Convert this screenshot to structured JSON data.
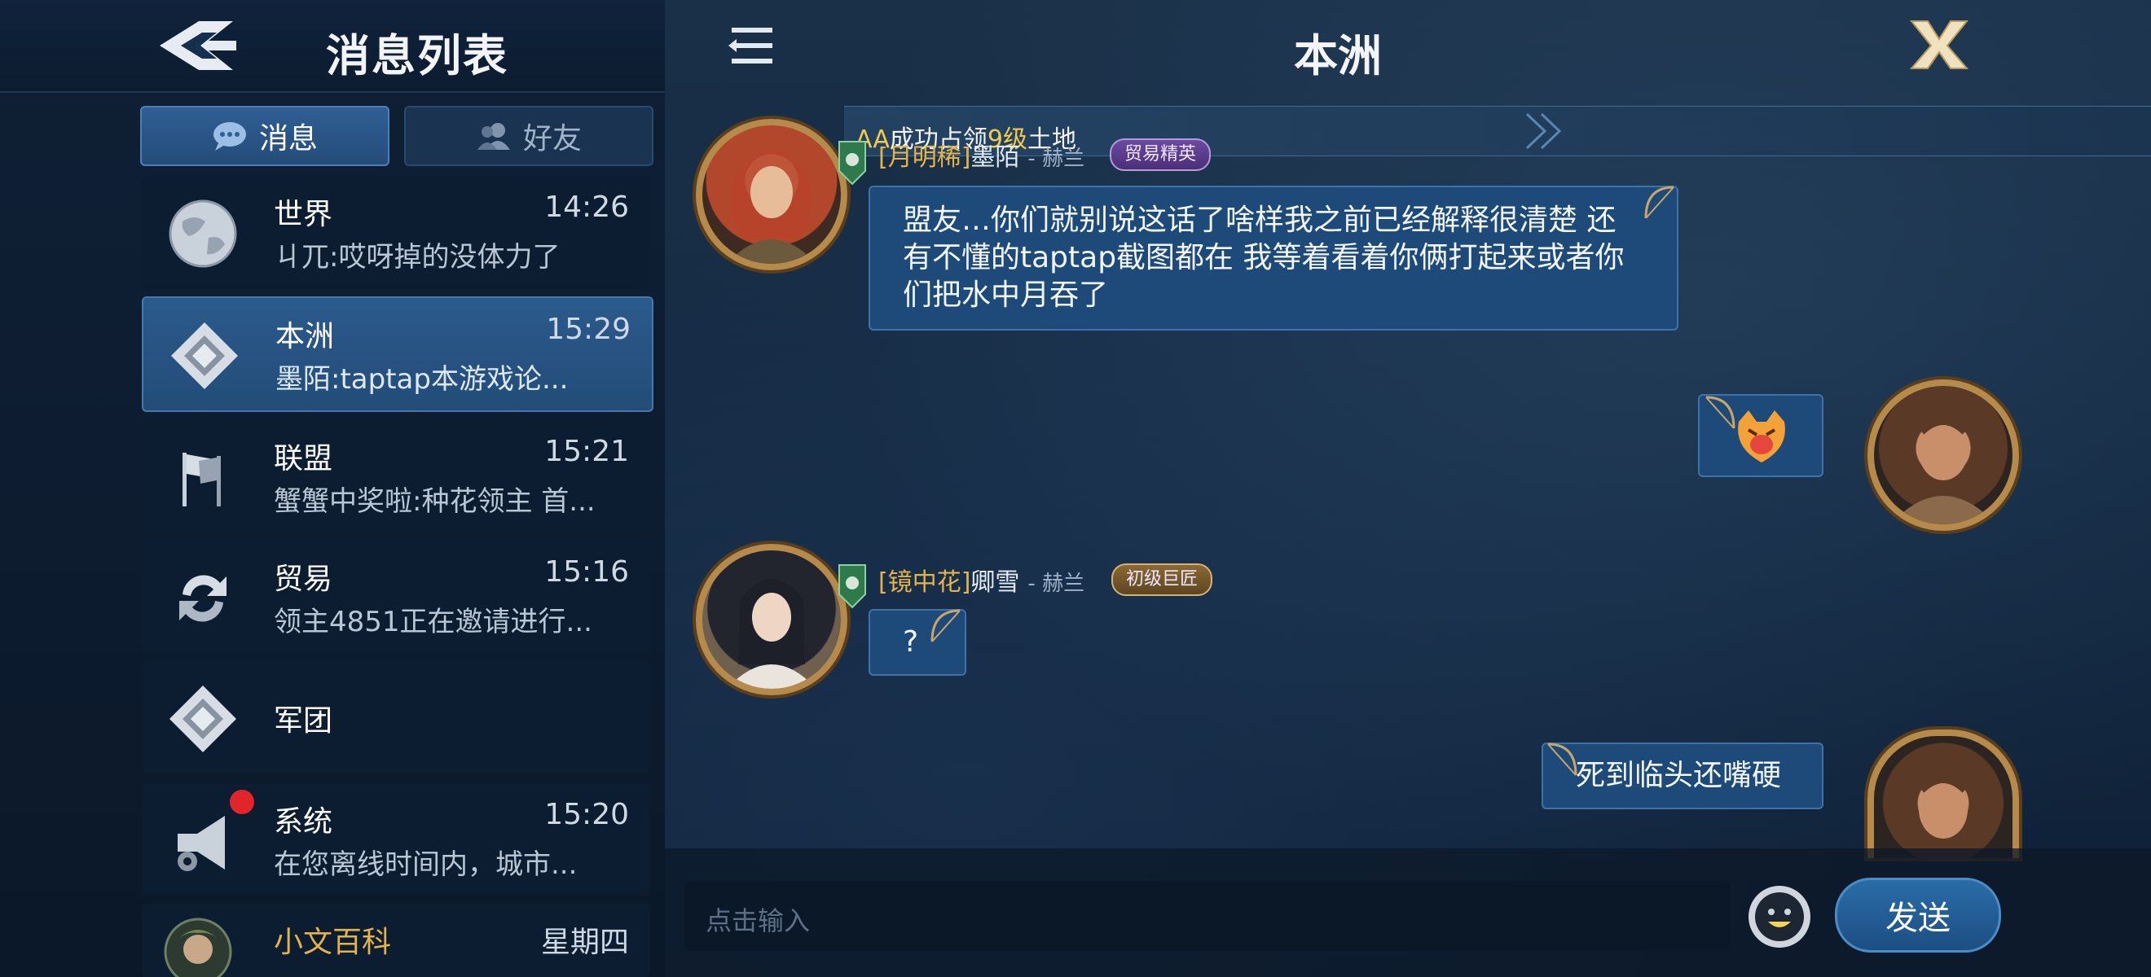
{
  "left_panel": {
    "title": "消息列表",
    "tabs": [
      {
        "label": "消息",
        "active": true
      },
      {
        "label": "好友",
        "active": false
      }
    ],
    "items": [
      {
        "name": "世界",
        "time": "14:26",
        "preview": "ㄐ兀:哎呀掉的没体力了",
        "icon": "globe-icon"
      },
      {
        "name": "本洲",
        "time": "15:29",
        "preview": "墨陌:taptap本游戏论...",
        "icon": "diamond-icon",
        "active": true
      },
      {
        "name": "联盟",
        "time": "15:21",
        "preview": "蟹蟹中奖啦:种花领主 首...",
        "icon": "flags-icon"
      },
      {
        "name": "贸易",
        "time": "15:16",
        "preview": "领主4851正在邀请进行...",
        "icon": "exchange-icon"
      },
      {
        "name": "军团",
        "time": "",
        "preview": "",
        "icon": "diamond-icon"
      },
      {
        "name": "系统",
        "time": "15:20",
        "preview": "在您离线时间内，城市...",
        "icon": "megaphone-icon"
      },
      {
        "name": "小文百科",
        "time": "星期四",
        "preview": "",
        "icon": "avatar"
      }
    ]
  },
  "chat": {
    "title": "本洲",
    "notice": {
      "name": "AA",
      "text1": "成功占领",
      "level": "9级",
      "text2": "土地"
    },
    "messages": [
      {
        "side": "left",
        "tag": "[月明稀]",
        "sender": "墨陌",
        "server": "- 赫兰",
        "rank": "贸易精英",
        "text": "盟友…你们就别说这话了啥样我之前已经解释很清楚 还有不懂的taptap截图都在 我等着看着你俩打起来或者你们把水中月吞了"
      },
      {
        "side": "right",
        "text": "",
        "sticker": "angry-cat-sticker"
      },
      {
        "side": "left",
        "tag": "[镜中花]",
        "sender": "卿雪",
        "server": "- 赫兰",
        "rank": "初级巨匠",
        "text": "?"
      },
      {
        "side": "right",
        "text": "死到临头还嘴硬"
      }
    ],
    "input": {
      "placeholder": "点击输入"
    },
    "send_label": "发送"
  },
  "colors": {
    "accent": "#2b5a8c",
    "gold": "#e4b44a",
    "bubble": "#1d4a78"
  }
}
